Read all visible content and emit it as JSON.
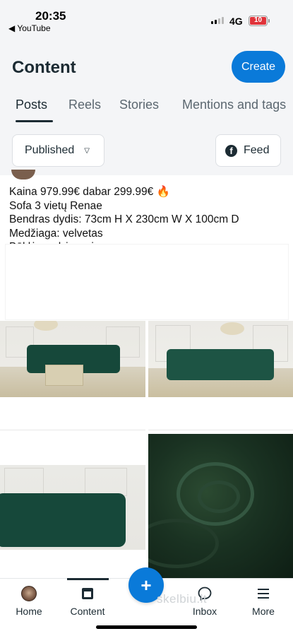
{
  "status_bar": {
    "time": "20:35",
    "back_app": "◀ YouTube",
    "network": "4G",
    "battery": "10"
  },
  "header": {
    "title": "Content",
    "create_label": "Create",
    "tabs": [
      {
        "label": "Posts",
        "active": true
      },
      {
        "label": "Reels",
        "active": false
      },
      {
        "label": "Stories",
        "active": false
      },
      {
        "label": "Mentions and tags",
        "active": false
      }
    ],
    "filter_label": "Published",
    "feed_label": "Feed"
  },
  "post": {
    "caption_lines": [
      "Kaina 979.99€ dabar 299.99€ 🔥",
      "Sofa 3 vietų Renae",
      "Bendras dydis: 73cm H X 230cm W X 100cm D",
      "Medžiaga: velvetas",
      "Būklė: prekė nauja"
    ]
  },
  "bottom_nav": {
    "items": [
      {
        "label": "Home",
        "icon": "profile-avatar-icon"
      },
      {
        "label": "Content",
        "icon": "content-icon",
        "active": true
      },
      {
        "label": "Inbox",
        "icon": "chat-bubble-icon"
      },
      {
        "label": "More",
        "icon": "menu-icon"
      }
    ],
    "fab_label": "+",
    "watermark": "skelbiu.lt"
  },
  "colors": {
    "accent": "#0a7ad9",
    "header_bg": "#f4f5f7",
    "sofa_green": "#16483a"
  }
}
